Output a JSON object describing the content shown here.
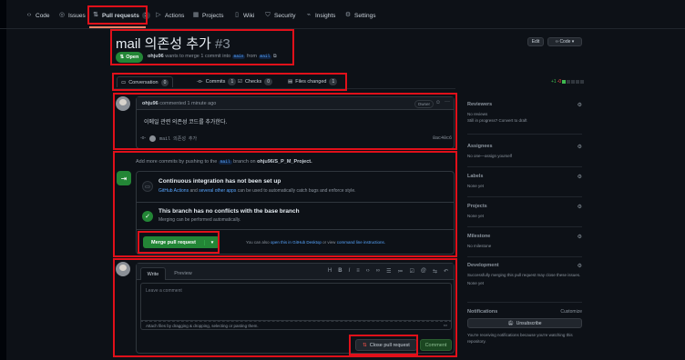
{
  "nav": {
    "items": [
      {
        "label": "Code",
        "icon": "code-icon"
      },
      {
        "label": "Issues",
        "icon": "issue-icon"
      },
      {
        "label": "Pull requests",
        "icon": "pull-request-icon",
        "count": "1"
      },
      {
        "label": "Actions",
        "icon": "play-icon"
      },
      {
        "label": "Projects",
        "icon": "table-icon"
      },
      {
        "label": "Wiki",
        "icon": "book-icon"
      },
      {
        "label": "Security",
        "icon": "shield-icon"
      },
      {
        "label": "Insights",
        "icon": "graph-icon"
      },
      {
        "label": "Settings",
        "icon": "gear-icon"
      }
    ]
  },
  "pr": {
    "title": "mail 의존성 추가",
    "number": "#3",
    "status": "Open",
    "author": "ohju96",
    "meta_text": "wants to merge 1 commit into",
    "base_branch": "main",
    "from_text": "from",
    "head_branch": "mail",
    "edit_label": "Edit",
    "code_label": "Code"
  },
  "tabs": [
    {
      "label": "Conversation",
      "count": "0"
    },
    {
      "label": "Commits",
      "count": "1"
    },
    {
      "label": "Checks",
      "count": "0"
    },
    {
      "label": "Files changed",
      "count": "1"
    }
  ],
  "diffstat": {
    "add": "+1",
    "del": "-0"
  },
  "comment": {
    "author": "ohju96",
    "time": "commented 1 minute ago",
    "role": "Owner",
    "body": "이메일 관련 의존성 코드를 추가한다.",
    "commit_msg": "mail 의존성 추가",
    "commit_sha": "8ac40c6"
  },
  "merge": {
    "add_more_prefix": "Add more commits by pushing to the",
    "add_more_branch": "mail",
    "add_more_mid": "branch on",
    "add_more_repo": "ohju96/S_P_M_Project.",
    "ci_title": "Continuous integration has not been set up",
    "ci_sub_link1": "GitHub Actions",
    "ci_sub_and": "and",
    "ci_sub_link2": "several other apps",
    "ci_sub_rest": "can be used to automatically catch bugs and enforce style.",
    "conflict_title": "This branch has no conflicts with the base branch",
    "conflict_sub": "Merging can be performed automatically.",
    "merge_button": "Merge pull request",
    "also_prefix": "You can also",
    "also_link1": "open this in GitHub Desktop",
    "also_mid": "or view",
    "also_link2": "command line instructions."
  },
  "write": {
    "tab_write": "Write",
    "tab_preview": "Preview",
    "placeholder": "Leave a comment",
    "attach_text": "Attach files by dragging & dropping, selecting or pasting them.",
    "close_button": "Close pull request",
    "comment_button": "Comment"
  },
  "sidebar": {
    "reviewers_h": "Reviewers",
    "reviewers_v1": "No reviews",
    "reviewers_v2": "Still in progress? Convert to draft",
    "assignees_h": "Assignees",
    "assignees_v": "No one—assign yourself",
    "labels_h": "Labels",
    "labels_v": "None yet",
    "projects_h": "Projects",
    "projects_v": "None yet",
    "milestone_h": "Milestone",
    "milestone_v": "No milestone",
    "development_h": "Development",
    "development_v1": "Successfully merging this pull request may close these issues.",
    "development_v2": "None yet",
    "notifications_h": "Notifications",
    "customize": "Customize",
    "unsubscribe": "Unsubscribe",
    "notif_v": "You're receiving notifications because you're watching this repository."
  },
  "colors": {
    "accent_green": "#238636",
    "link_blue": "#58a6ff",
    "highlight_red": "#e0101a",
    "bg": "#0d1117"
  }
}
